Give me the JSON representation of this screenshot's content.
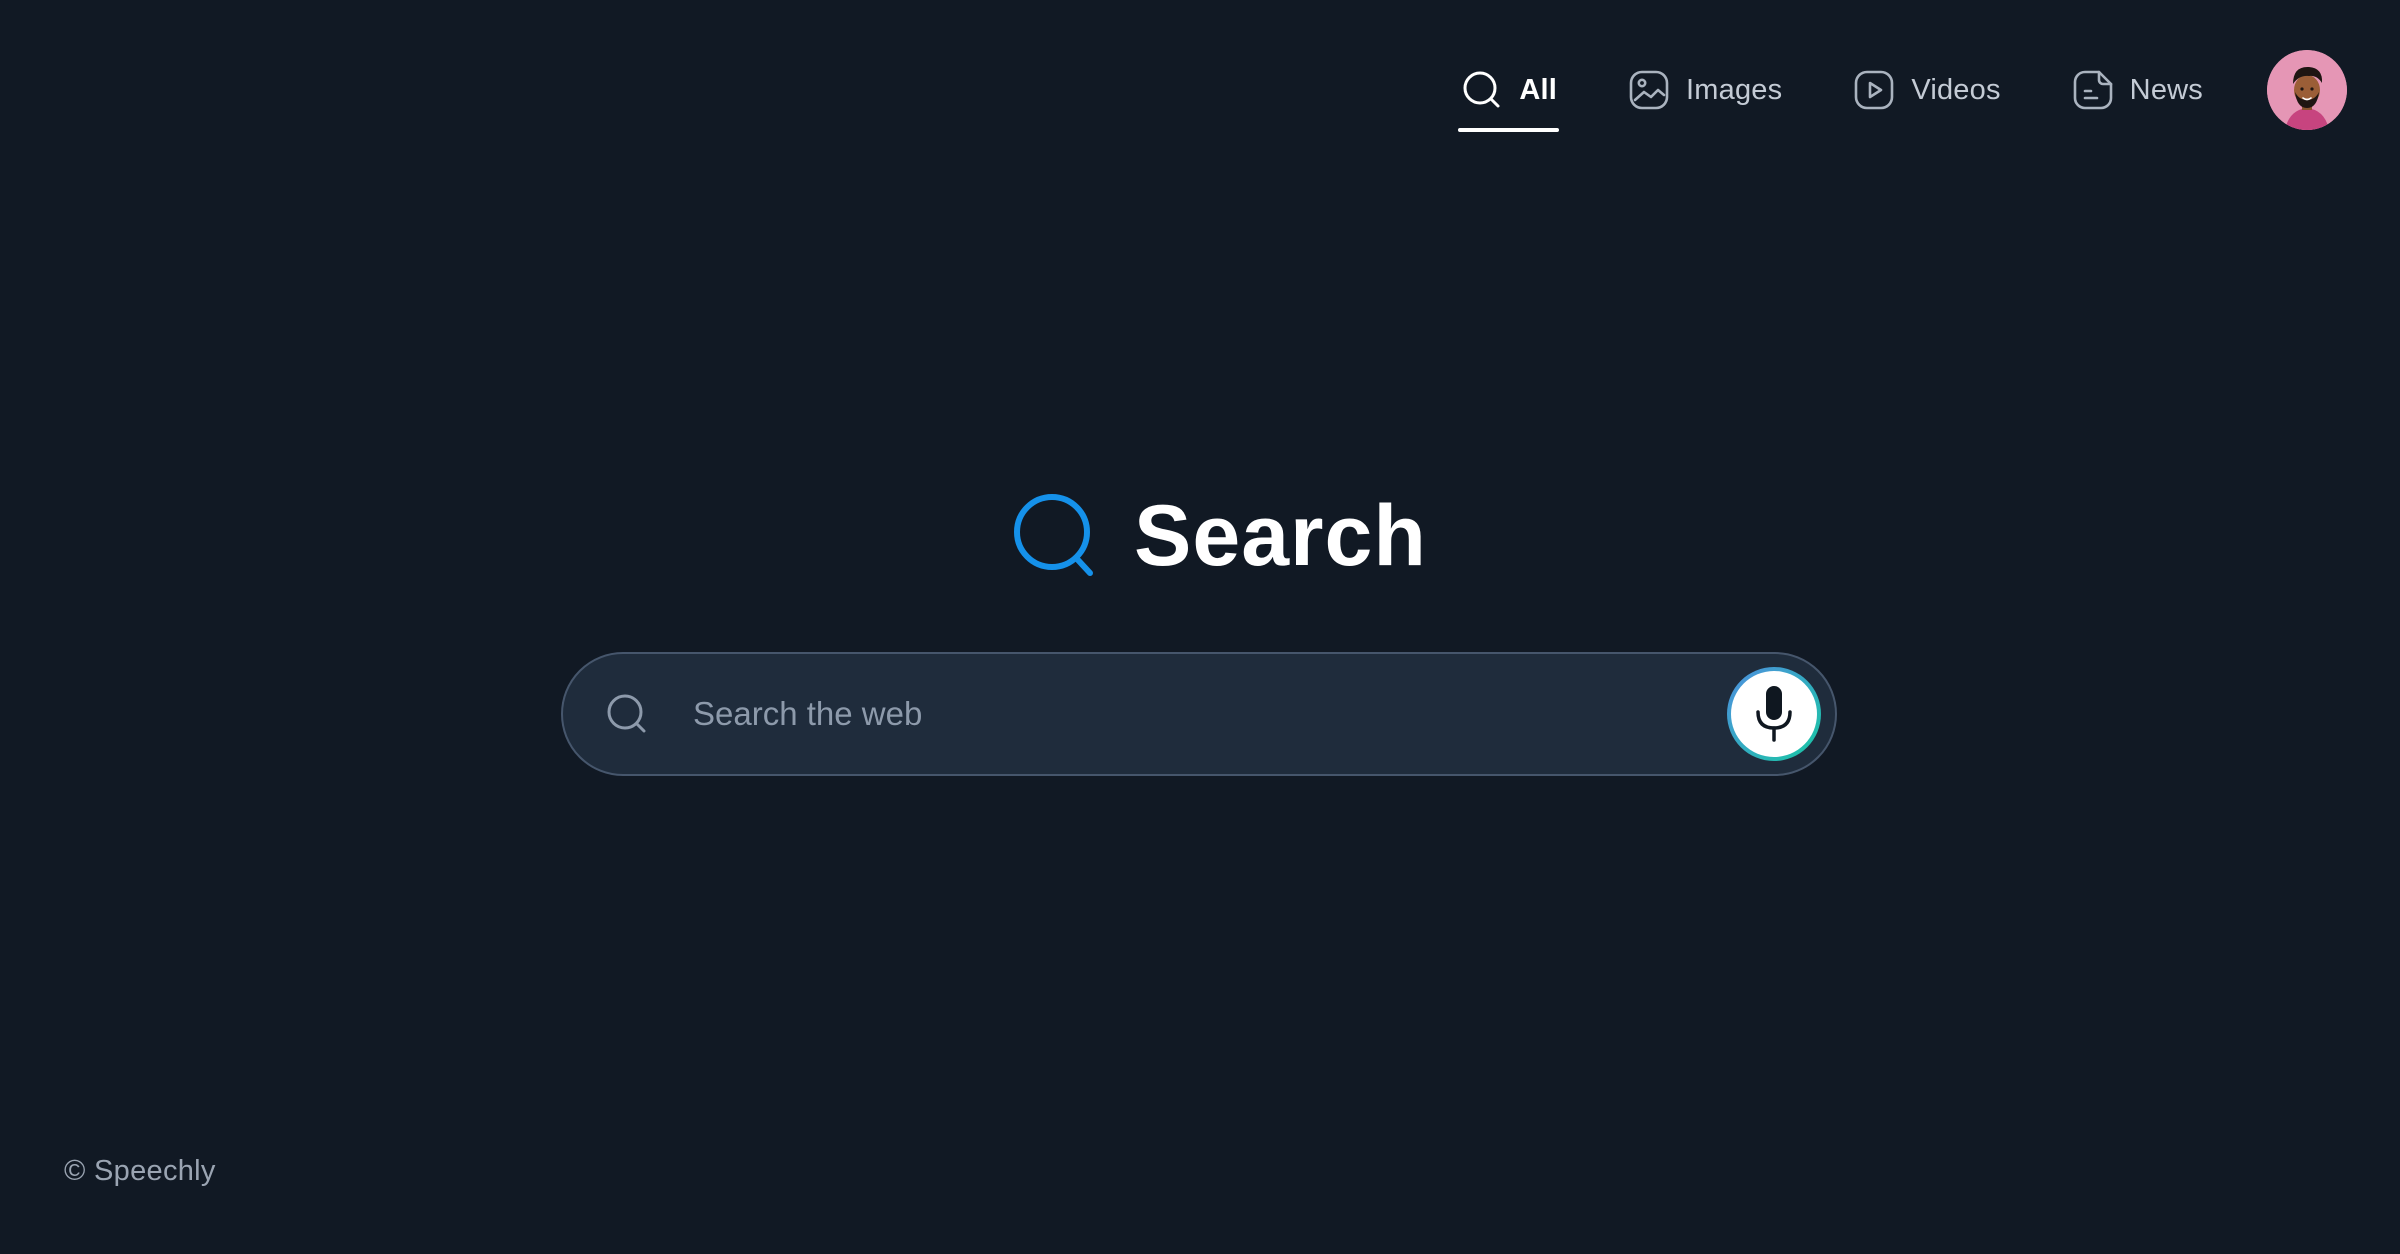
{
  "nav": {
    "tabs": [
      {
        "label": "All",
        "icon": "search-icon",
        "active": true
      },
      {
        "label": "Images",
        "icon": "image-icon",
        "active": false
      },
      {
        "label": "Videos",
        "icon": "play-icon",
        "active": false
      },
      {
        "label": "News",
        "icon": "document-icon",
        "active": false
      }
    ],
    "avatar_icon": "user-avatar"
  },
  "logo": {
    "text": "Search",
    "icon": "search-icon",
    "icon_color": "#1591ea"
  },
  "search": {
    "placeholder": "Search the web",
    "value": "",
    "mic_icon": "microphone-icon"
  },
  "footer": {
    "copyright": "© Speechly"
  },
  "colors": {
    "background": "#111924",
    "search_bar_fill": "#1f2c3c",
    "search_bar_border": "#46566c",
    "accent": "#1591ea",
    "mic_ring_start": "#4f8fe0",
    "mic_ring_end": "#18c7a3",
    "avatar_bg": "#e596b5"
  }
}
